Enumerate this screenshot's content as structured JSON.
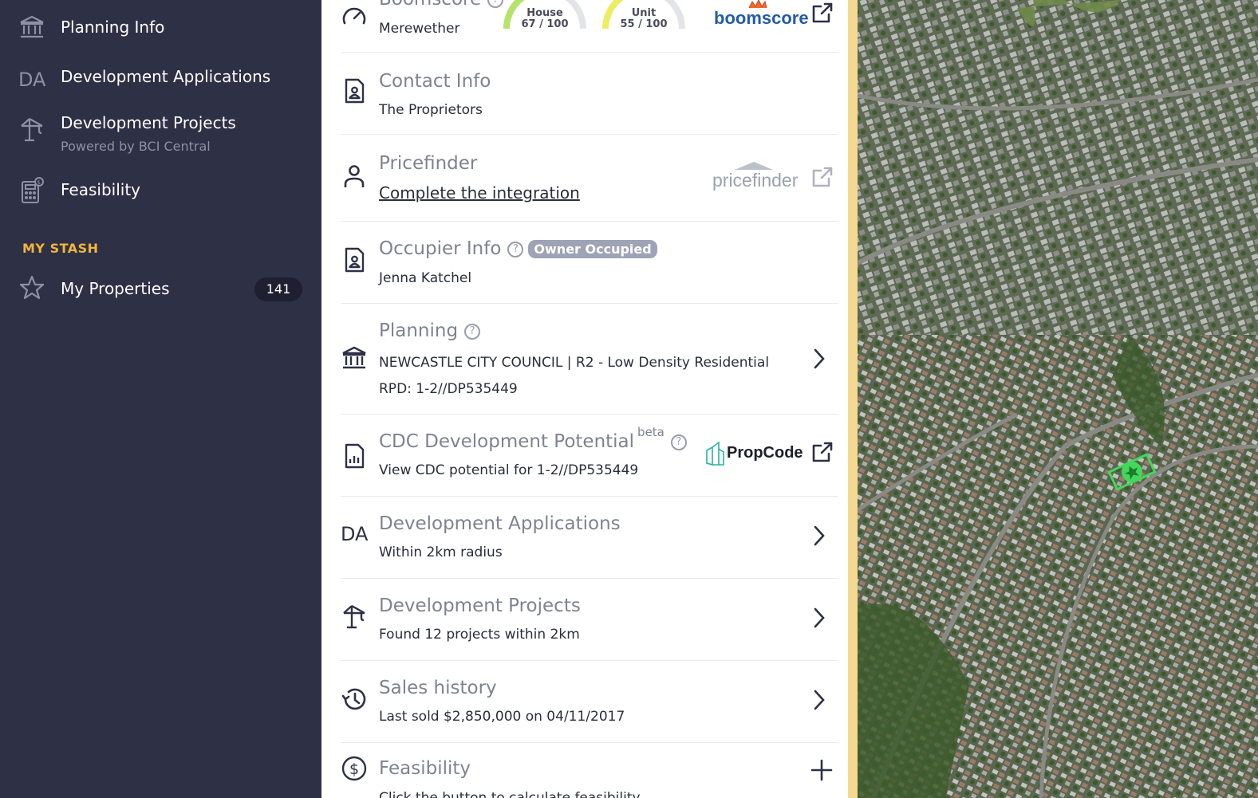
{
  "sidebar": {
    "items": [
      {
        "label": "Planning Info",
        "icon": "bank-icon"
      },
      {
        "label": "Development Applications",
        "icon_text": "DA"
      },
      {
        "label": "Development Projects",
        "sub": "Powered by BCI Central",
        "icon": "crane-icon"
      },
      {
        "label": "Feasibility",
        "icon": "calculator-icon"
      }
    ],
    "stash_heading": "MY STASH",
    "my_properties": {
      "label": "My Properties",
      "count": "141"
    }
  },
  "boomscore": {
    "title": "Boomscore",
    "subtitle": "Merewether",
    "house_label": "House",
    "house_score": "67 / 100",
    "house_value": 67,
    "unit_label": "Unit",
    "unit_score": "55 / 100",
    "unit_value": 55,
    "brand": "boomscore"
  },
  "contact": {
    "title": "Contact Info",
    "line": "The Proprietors"
  },
  "pricefinder": {
    "title": "Pricefinder",
    "link": "Complete the integration",
    "brand": "pricefinder"
  },
  "occupier": {
    "title": "Occupier Info",
    "badge": "Owner Occupied",
    "line": "Jenna Katchel"
  },
  "planning": {
    "title": "Planning",
    "line1": "NEWCASTLE CITY COUNCIL | R2 - Low Density Residential",
    "line2": "RPD: 1-2//DP535449"
  },
  "cdc": {
    "title": "CDC Development Potential",
    "beta": "beta",
    "line": "View CDC potential for 1-2//DP535449",
    "brand": "PropCode"
  },
  "das": {
    "icon_text": "DA",
    "title": "Development Applications",
    "line": "Within 2km radius"
  },
  "projects": {
    "title": "Development Projects",
    "line": "Found 12 projects within 2km"
  },
  "sales": {
    "title": "Sales history",
    "line": "Last sold $2,850,000 on 04/11/2017"
  },
  "feasibility": {
    "title": "Feasibility",
    "line": "Click the button to calculate feasibility"
  },
  "colors": {
    "sidebar_bg": "#2e3046",
    "accent_yellow": "#f2b53a",
    "house_gauge": "#b6e36a",
    "unit_gauge": "#ecee61",
    "marker_green": "#42d85a"
  }
}
